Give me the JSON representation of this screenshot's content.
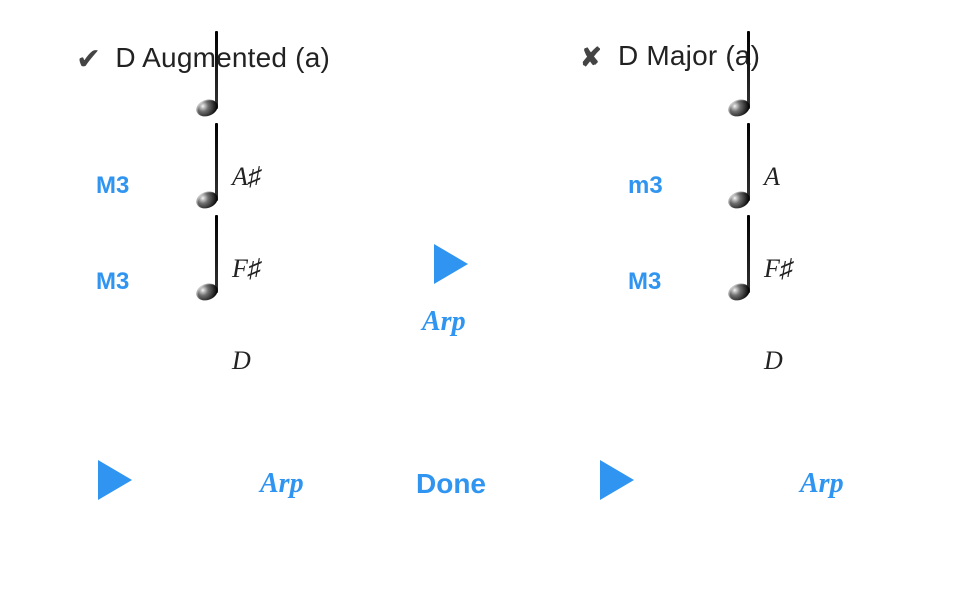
{
  "left": {
    "status": "correct",
    "title": "D Augmented (a)",
    "notes": [
      {
        "name": "A♯",
        "intervalBelow": "M3"
      },
      {
        "name": "F♯",
        "intervalBelow": "M3"
      },
      {
        "name": "D",
        "intervalBelow": null
      }
    ],
    "arpLabel": "Arp"
  },
  "right": {
    "status": "incorrect",
    "title": "D Major (a)",
    "notes": [
      {
        "name": "A",
        "intervalBelow": "m3"
      },
      {
        "name": "F♯",
        "intervalBelow": "M3"
      },
      {
        "name": "D",
        "intervalBelow": null
      }
    ],
    "arpLabel": "Arp"
  },
  "center": {
    "arpLabel": "Arp",
    "doneLabel": "Done"
  }
}
